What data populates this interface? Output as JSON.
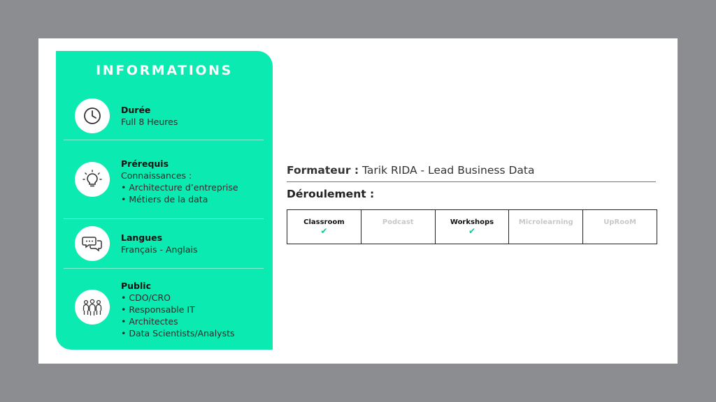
{
  "panel": {
    "title": "INFORMATIONS",
    "duree": {
      "label": "Durée",
      "value": "Full 8 Heures"
    },
    "prerequis": {
      "label": "Prérequis",
      "lines": [
        "Connaissances :",
        "• Architecture d’entreprise",
        "• Métiers de la data"
      ]
    },
    "langues": {
      "label": "Langues",
      "value": "Français - Anglais"
    },
    "public": {
      "label": "Public",
      "lines": [
        "• CDO/CRO",
        "• Responsable IT",
        "• Architectes",
        "• Data Scientists/Analysts"
      ]
    },
    "accent_color": "#0beab0"
  },
  "formateur": {
    "label": "Formateur :",
    "value": "Tarik RIDA - Lead Business Data"
  },
  "deroulement": {
    "label": "Déroulement :"
  },
  "modes": [
    {
      "label": "Classroom",
      "active": true,
      "check": "✔"
    },
    {
      "label": "Podcast",
      "active": false
    },
    {
      "label": "Workshops",
      "active": true,
      "check": "✔"
    },
    {
      "label": "Microlearning",
      "active": false
    },
    {
      "label": "UpRooM",
      "active": false
    }
  ],
  "icons": [
    "clock-icon",
    "lightbulb-icon",
    "chat-bubbles-icon",
    "group-icon"
  ]
}
